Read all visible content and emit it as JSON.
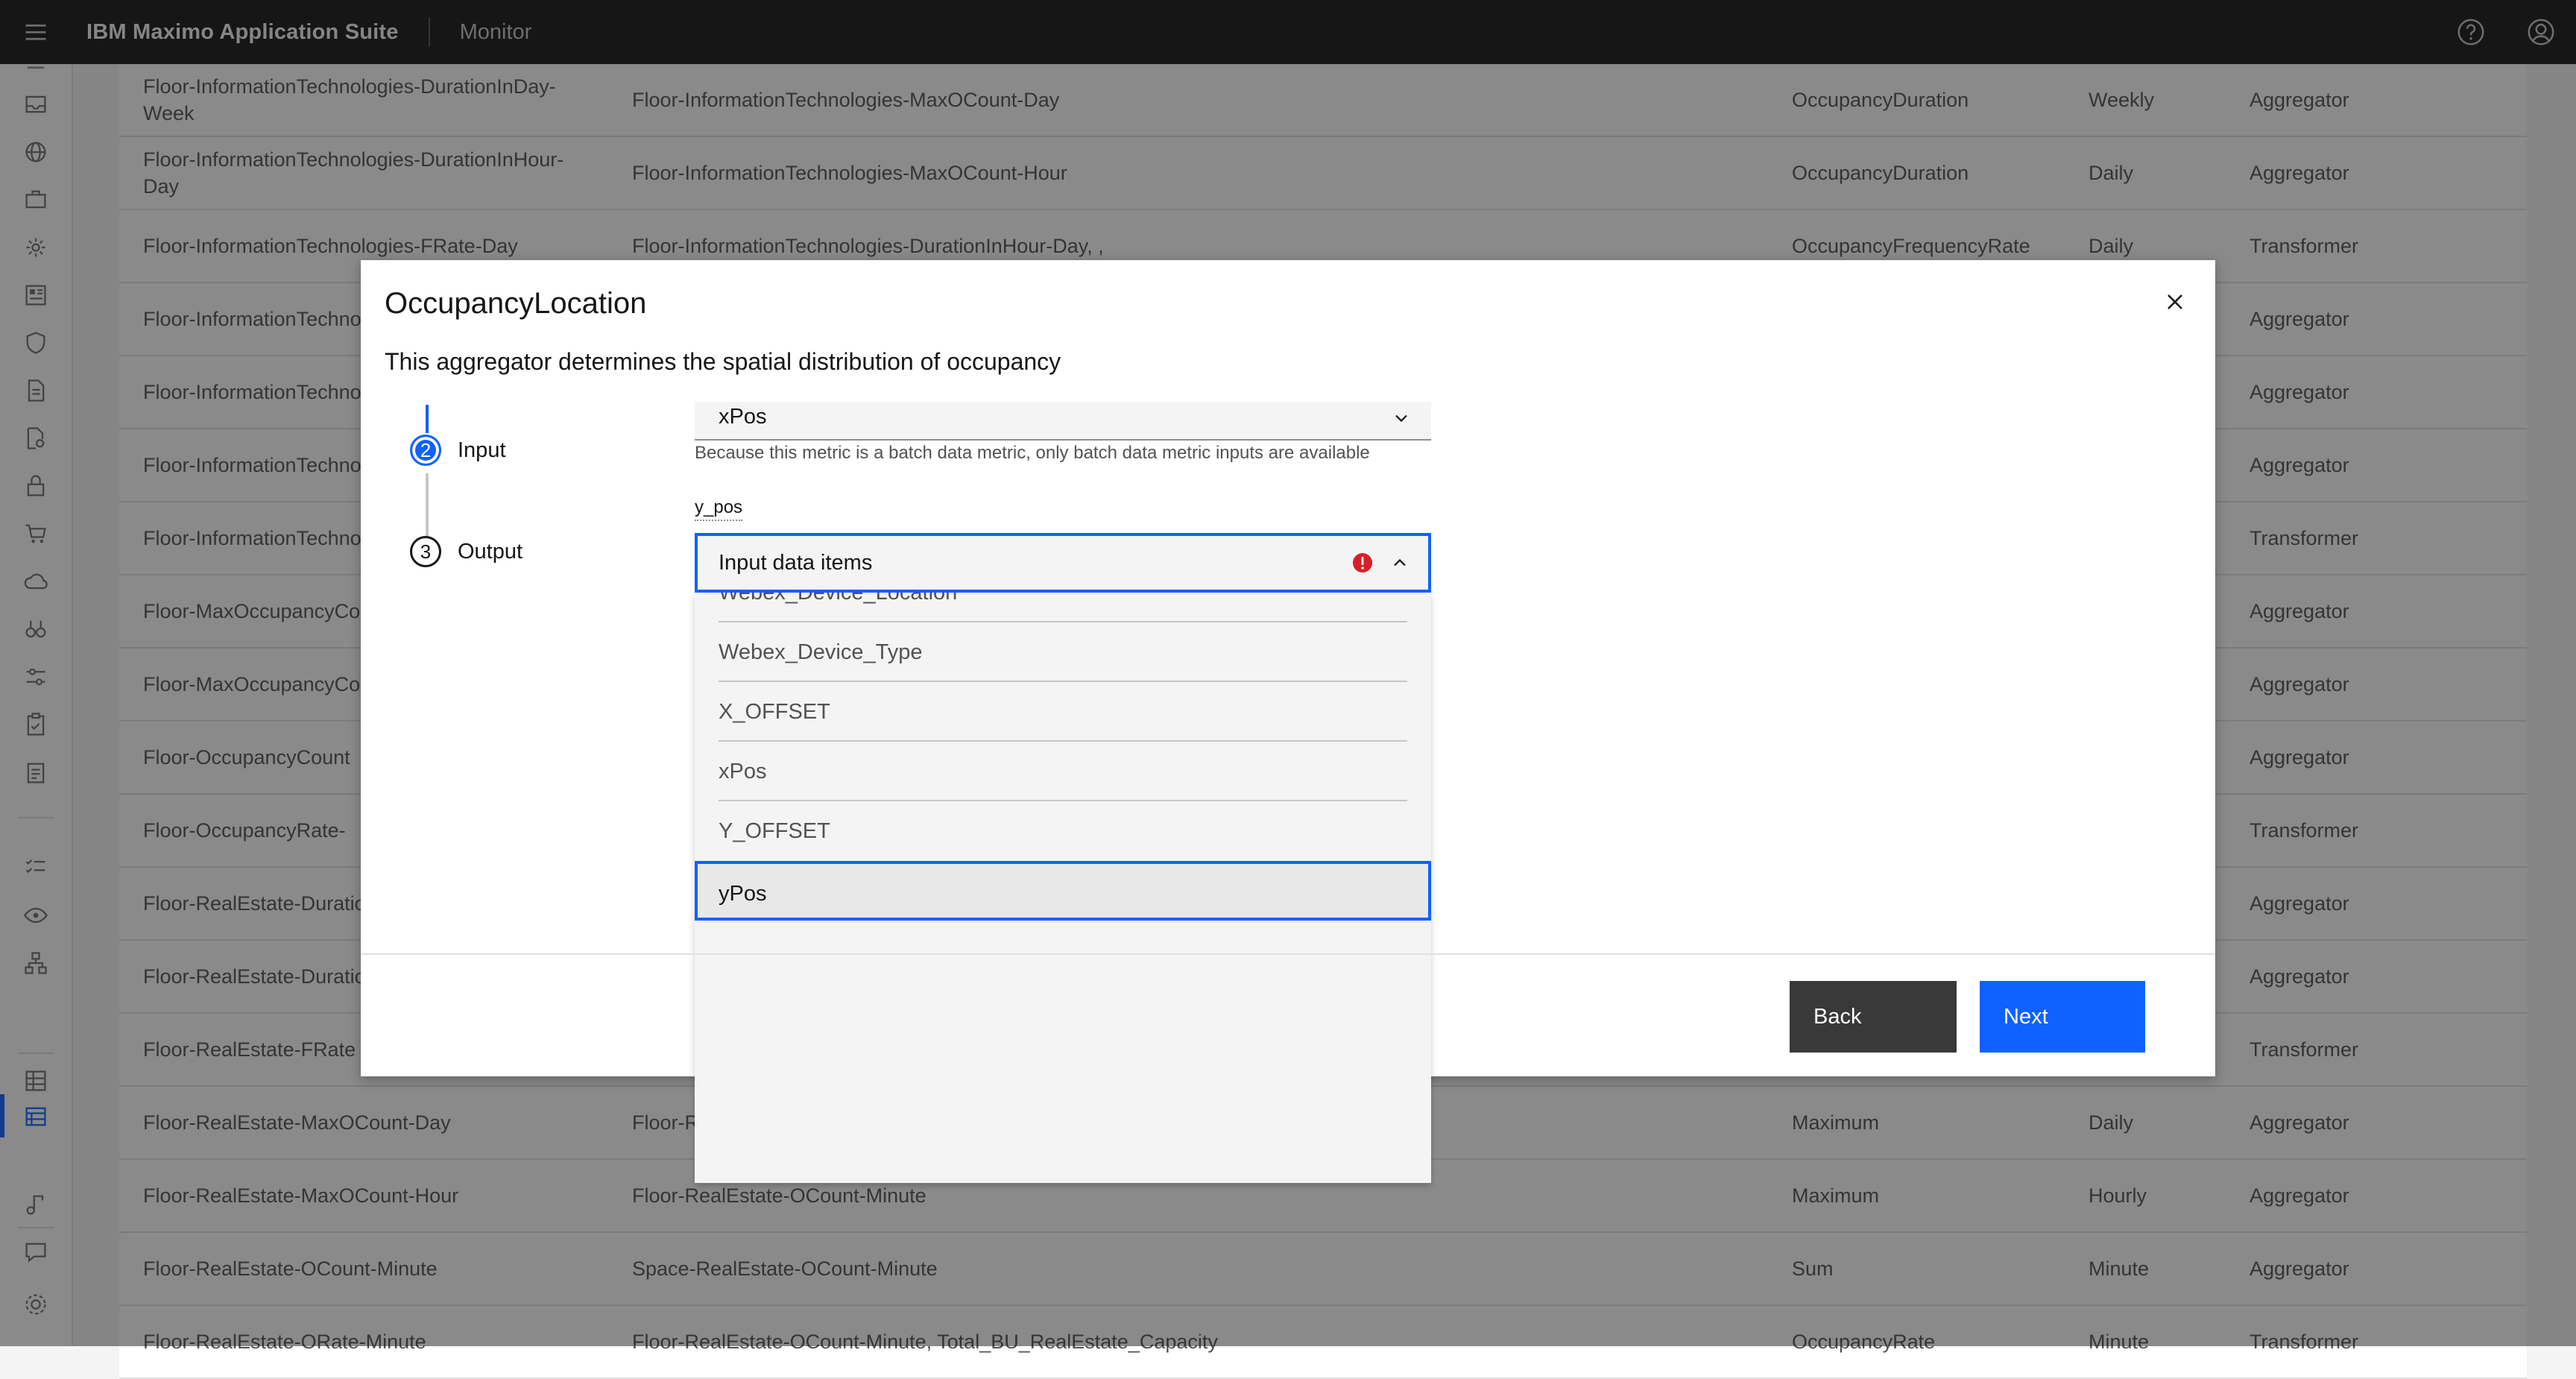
{
  "header": {
    "brand": "IBM Maximo Application Suite",
    "app": "Monitor",
    "icons": [
      "menu-icon",
      "help-icon",
      "user-avatar-icon"
    ]
  },
  "table": {
    "rows": [
      {
        "name": "Floor-InformationTechnologies-DurationInDay-Week",
        "input": "Floor-InformationTechnologies-MaxOCount-Day",
        "func": "OccupancyDuration",
        "freq": "Weekly",
        "type": "Aggregator"
      },
      {
        "name": "Floor-InformationTechnologies-DurationInHour-Day",
        "input": "Floor-InformationTechnologies-MaxOCount-Hour",
        "func": "OccupancyDuration",
        "freq": "Daily",
        "type": "Aggregator"
      },
      {
        "name": "Floor-InformationTechnologies-FRate-Day",
        "input": "Floor-InformationTechnologies-DurationInHour-Day, ,",
        "func": "OccupancyFrequencyRate",
        "freq": "Daily",
        "type": "Transformer"
      },
      {
        "name": "Floor-InformationTechnologies-Day",
        "input": "",
        "func": "",
        "freq": "",
        "type": "Aggregator"
      },
      {
        "name": "Floor-InformationTechnologies-Hour",
        "input": "",
        "func": "",
        "freq": "",
        "type": "Aggregator"
      },
      {
        "name": "Floor-InformationTechnologies-Minute",
        "input": "",
        "func": "",
        "freq": "",
        "type": "Aggregator"
      },
      {
        "name": "Floor-InformationTechnologies",
        "input": "",
        "func": "",
        "freq": "",
        "type": "Transformer"
      },
      {
        "name": "Floor-MaxOccupancyCount",
        "input": "",
        "func": "",
        "freq": "",
        "type": "Aggregator"
      },
      {
        "name": "Floor-MaxOccupancyCount",
        "input": "",
        "func": "",
        "freq": "",
        "type": "Aggregator"
      },
      {
        "name": "Floor-OccupancyCount",
        "input": "",
        "func": "",
        "freq": "",
        "type": "Aggregator"
      },
      {
        "name": "Floor-OccupancyRate-",
        "input": "",
        "func": "",
        "freq": "",
        "type": "Transformer"
      },
      {
        "name": "Floor-RealEstate-DurationInDay",
        "input": "",
        "func": "",
        "freq": "",
        "type": "Aggregator"
      },
      {
        "name": "Floor-RealEstate-DurationInHour",
        "input": "",
        "func": "",
        "freq": "",
        "type": "Aggregator"
      },
      {
        "name": "Floor-RealEstate-FRate",
        "input": "",
        "func": "",
        "freq": "",
        "type": "Transformer"
      },
      {
        "name": "Floor-RealEstate-MaxOCount-Day",
        "input": "Floor-RealEstate-OCount-Minute",
        "func": "Maximum",
        "freq": "Daily",
        "type": "Aggregator"
      },
      {
        "name": "Floor-RealEstate-MaxOCount-Hour",
        "input": "Floor-RealEstate-OCount-Minute",
        "func": "Maximum",
        "freq": "Hourly",
        "type": "Aggregator"
      },
      {
        "name": "Floor-RealEstate-OCount-Minute",
        "input": "Space-RealEstate-OCount-Minute",
        "func": "Sum",
        "freq": "Minute",
        "type": "Aggregator"
      },
      {
        "name": "Floor-RealEstate-ORate-Minute",
        "input": "Floor-RealEstate-OCount-Minute, Total_BU_RealEstate_Capacity",
        "func": "OccupancyRate",
        "freq": "Minute",
        "type": "Transformer"
      }
    ]
  },
  "modal": {
    "title": "OccupancyLocation",
    "description": "This aggregator determines the spatial distribution of occupancy",
    "steps": [
      {
        "number": "2",
        "label": "Input",
        "state": "current"
      },
      {
        "number": "3",
        "label": "Output",
        "state": "upcoming"
      }
    ],
    "x_select_value": "xPos",
    "helper_text": "Because this metric is a batch data metric, only batch data metric inputs are available",
    "y_label": "y_pos",
    "y_dropdown_placeholder": "Input data items",
    "y_dropdown_state": "invalid",
    "menu_items": [
      "Webex_Device_Location",
      "Webex_Device_Type",
      "X_OFFSET",
      "xPos",
      "Y_OFFSET",
      "yPos"
    ],
    "selected_menu_item": "yPos",
    "back_label": "Back",
    "next_label": "Next"
  },
  "colors": {
    "accent": "#0f62fe",
    "error": "#da1e28",
    "header_bg": "#161616",
    "secondary_button": "#393939"
  }
}
